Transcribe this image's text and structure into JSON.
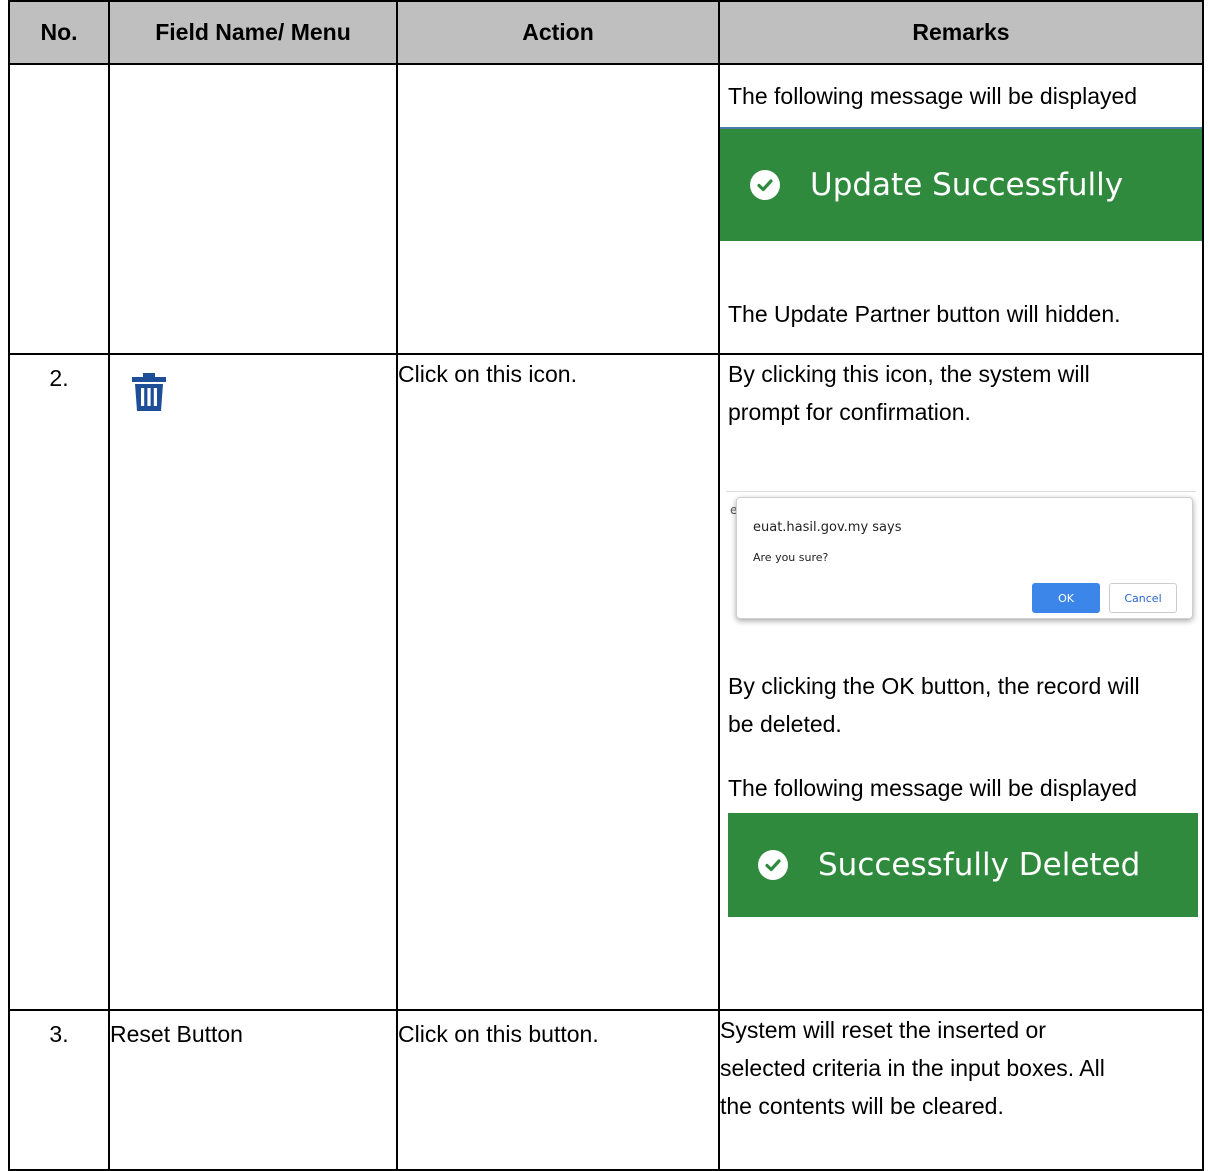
{
  "headers": {
    "no": "No.",
    "field": "Field Name/ Menu",
    "action": "Action",
    "remarks": "Remarks"
  },
  "row1": {
    "remark_msg": "The following message will be displayed",
    "toast_text": "Update Successfully",
    "remark_after": "The Update Partner button will hidden."
  },
  "row2": {
    "no": "2.",
    "icon": "trash-icon",
    "action": "Click on this icon.",
    "remark_line1": "By clicking this icon, the system will",
    "remark_line2": "prompt for confirmation.",
    "dialog": {
      "ghost_char": "e",
      "title": "euat.hasil.gov.my says",
      "message": "Are you sure?",
      "ok_label": "OK",
      "cancel_label": "Cancel"
    },
    "remark_ok_line1": "By clicking the OK button, the record will",
    "remark_ok_line2": "be deleted.",
    "remark_msg": "The following message will be displayed",
    "toast_text": "Successfully Deleted"
  },
  "row3": {
    "no": "3.",
    "field": "Reset Button",
    "action": "Click on this button.",
    "remark_line1": "System will reset the inserted or",
    "remark_line2": "selected criteria in the input boxes. All",
    "remark_line3": "the contents will be cleared."
  },
  "colors": {
    "header_bg": "#bfbfbf",
    "toast_green": "#2f8a3e",
    "icon_blue": "#1f4e99",
    "ok_blue": "#3b86e8"
  }
}
